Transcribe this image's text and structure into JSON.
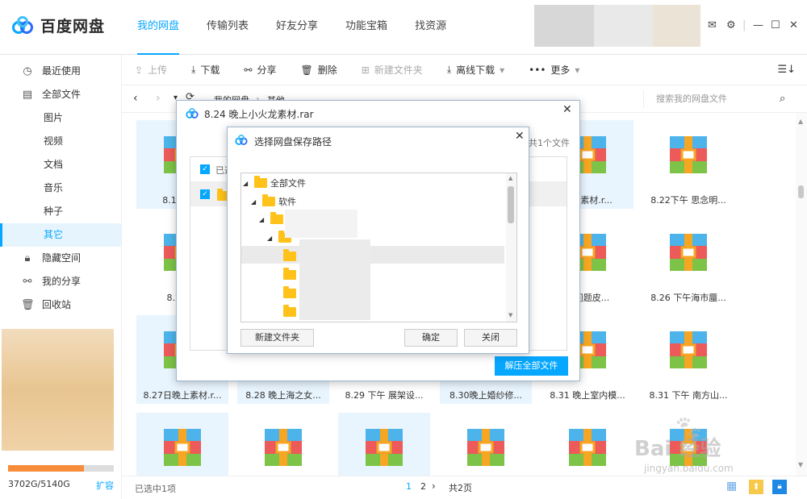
{
  "app": {
    "title": "百度网盘"
  },
  "nav": [
    {
      "label": "我的网盘",
      "active": true
    },
    {
      "label": "传输列表",
      "active": false
    },
    {
      "label": "好友分享",
      "active": false
    },
    {
      "label": "功能宝箱",
      "active": false
    },
    {
      "label": "找资源",
      "active": false
    }
  ],
  "sidebar": {
    "items": [
      {
        "label": "最近使用",
        "icon": "clock-icon",
        "sub": false,
        "active": false
      },
      {
        "label": "全部文件",
        "icon": "file-icon",
        "sub": false,
        "active": false
      },
      {
        "label": "图片",
        "sub": true,
        "active": false
      },
      {
        "label": "视频",
        "sub": true,
        "active": false
      },
      {
        "label": "文档",
        "sub": true,
        "active": false
      },
      {
        "label": "音乐",
        "sub": true,
        "active": false
      },
      {
        "label": "种子",
        "sub": true,
        "active": false
      },
      {
        "label": "其它",
        "sub": true,
        "active": true
      },
      {
        "label": "隐藏空间",
        "icon": "lock-icon",
        "sub": false,
        "active": false
      },
      {
        "label": "我的分享",
        "icon": "share-icon",
        "sub": false,
        "active": false
      },
      {
        "label": "回收站",
        "icon": "trash-icon",
        "sub": false,
        "active": false
      }
    ],
    "storage": {
      "text": "3702G/5140G",
      "used_fraction": 0.72,
      "expand_label": "扩容"
    }
  },
  "toolbar": {
    "upload": "上传",
    "download": "下载",
    "share": "分享",
    "delete": "删除",
    "new_folder": "新建文件夹",
    "offline": "离线下载",
    "more": "更多"
  },
  "path": {
    "root": "我的网盘",
    "current": "其他",
    "search_placeholder": "搜索我的网盘文件"
  },
  "files": [
    "8.19 晚...",
    "",
    "",
    "",
    "晚上素材.r...",
    "8.22下午 思念明...",
    "8.23 晚",
    "",
    "",
    "",
    "上问题皮...",
    "8.26 下午海市蜃...",
    "8.27日晚上素材.r...",
    "8.28 晚上海之女...",
    "8.29 下午 展架设...",
    "8.30晚上婚纱修...",
    "8.31 晚上室内模...",
    "8.31 下午 南方山...",
    "",
    "",
    "",
    "",
    "",
    ""
  ],
  "footer": {
    "selected": "已选中1项",
    "page1": "1",
    "page2": "2",
    "total": "共2页"
  },
  "dialog_extract": {
    "title": "8.24 晚上小火龙素材.rar",
    "selected_label": "已选",
    "count_label": "共1个文件",
    "extract_all": "解压全部文件"
  },
  "dialog_path": {
    "title": "选择网盘保存路径",
    "tree_root": "全部文件",
    "tree_child": "软件",
    "new_folder": "新建文件夹",
    "ok": "确定",
    "close": "关闭"
  },
  "watermark": {
    "brand": "Bai 经验",
    "url": "jingyan.baidu.com"
  },
  "colors": {
    "accent": "#06a7ff",
    "orange": "#f78c3a"
  }
}
